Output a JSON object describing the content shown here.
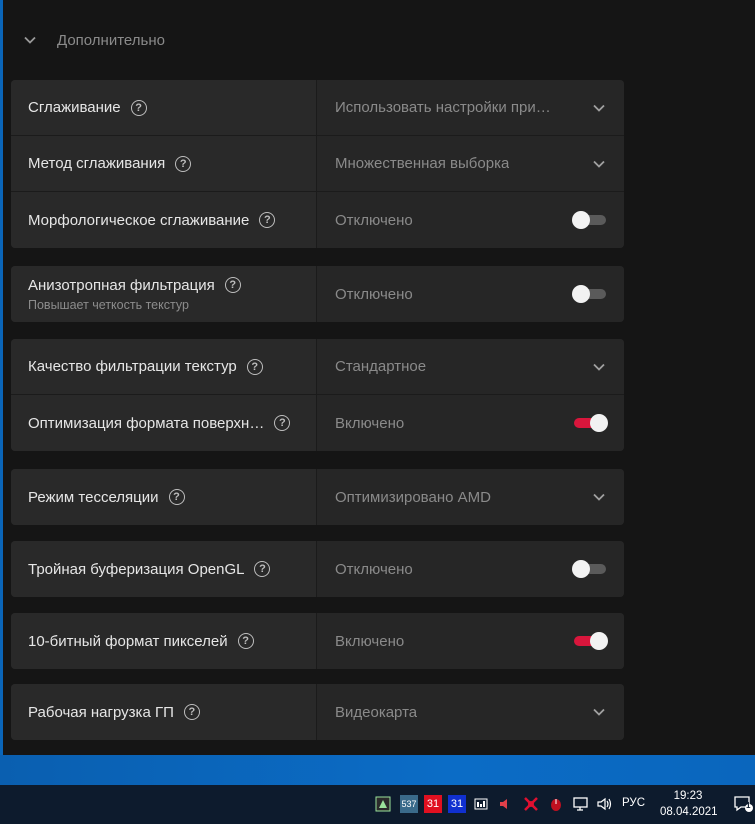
{
  "section": {
    "title": "Дополнительно"
  },
  "groups": [
    {
      "rows": [
        {
          "label": "Сглаживание",
          "value": "Использовать настройки при…",
          "control": "dropdown"
        },
        {
          "label": "Метод сглаживания",
          "value": "Множественная выборка",
          "control": "dropdown"
        },
        {
          "label": "Морфологическое сглаживание",
          "value": "Отключено",
          "control": "toggle",
          "on": false
        }
      ]
    },
    {
      "rows": [
        {
          "label": "Анизотропная фильтрация",
          "sublabel": "Повышает четкость текстур",
          "value": "Отключено",
          "control": "toggle",
          "on": false
        }
      ]
    },
    {
      "rows": [
        {
          "label": "Качество фильтрации текстур",
          "value": "Стандартное",
          "control": "dropdown"
        },
        {
          "label": "Оптимизация формата поверхн…",
          "value": "Включено",
          "control": "toggle",
          "on": true
        }
      ]
    },
    {
      "rows": [
        {
          "label": "Режим тесселяции",
          "value": "Оптимизировано AMD",
          "control": "dropdown"
        }
      ]
    },
    {
      "rows": [
        {
          "label": "Тройная буферизация OpenGL",
          "value": "Отключено",
          "control": "toggle",
          "on": false
        }
      ]
    },
    {
      "rows": [
        {
          "label": "10-битный формат пикселей",
          "value": "Включено",
          "control": "toggle",
          "on": true
        }
      ]
    },
    {
      "rows": [
        {
          "label": "Рабочая нагрузка ГП",
          "value": "Видеокарта",
          "control": "dropdown"
        }
      ]
    }
  ],
  "taskbar": {
    "tray_badges": [
      "537",
      "31",
      "31"
    ],
    "language": "РУС",
    "time": "19:23",
    "date": "08.04.2021",
    "notification_count": "1"
  },
  "colors": {
    "accent": "#d9163c",
    "panel": "#262626",
    "background": "#151515"
  }
}
